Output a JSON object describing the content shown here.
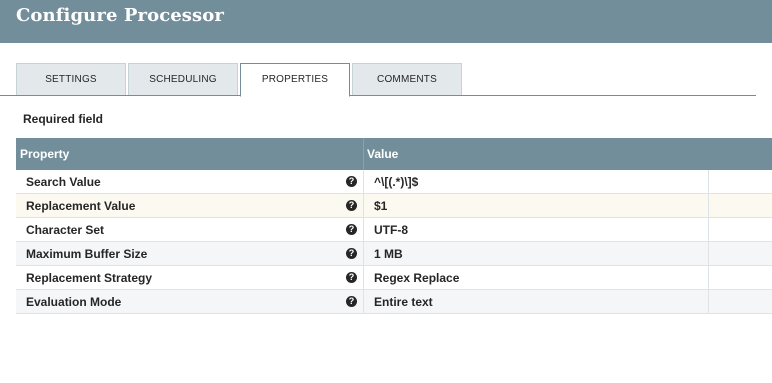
{
  "header": {
    "title": "Configure Processor"
  },
  "tabs": [
    {
      "label": "SETTINGS"
    },
    {
      "label": "SCHEDULING"
    },
    {
      "label": "PROPERTIES"
    },
    {
      "label": "COMMENTS"
    }
  ],
  "active_tab": "PROPERTIES",
  "required_label": "Required field",
  "grid": {
    "headers": {
      "property": "Property",
      "value": "Value"
    },
    "help_icon": "question-circle-icon",
    "rows": [
      {
        "name": "Search Value",
        "value": "^\\[(.*)\\]$",
        "help": "?"
      },
      {
        "name": "Replacement Value",
        "value": "$1",
        "help": "?"
      },
      {
        "name": "Character Set",
        "value": "UTF-8",
        "help": "?"
      },
      {
        "name": "Maximum Buffer Size",
        "value": "1 MB",
        "help": "?"
      },
      {
        "name": "Replacement Strategy",
        "value": "Regex Replace",
        "help": "?"
      },
      {
        "name": "Evaluation Mode",
        "value": "Entire text",
        "help": "?"
      }
    ]
  },
  "colors": {
    "header_bg": "#728e9b",
    "tab_bg": "#e3e8eb",
    "highlight_row": "#fcfaf0"
  }
}
